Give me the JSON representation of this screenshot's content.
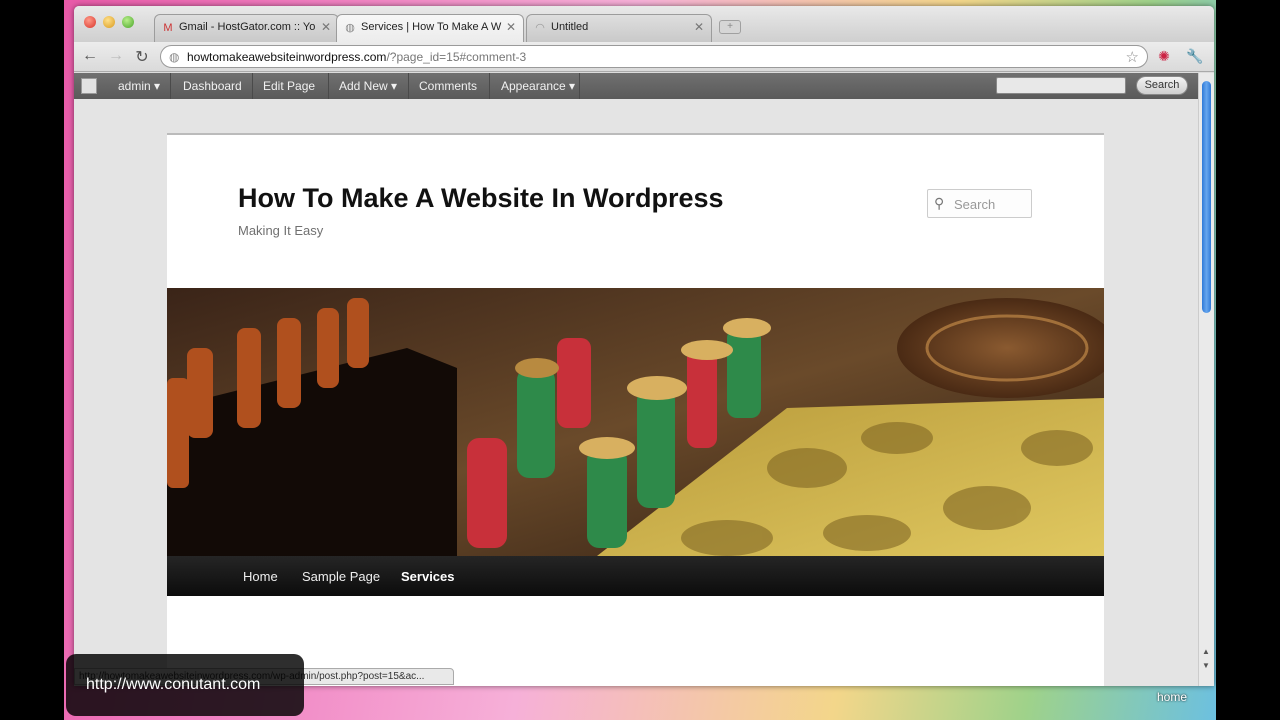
{
  "browser": {
    "tabs": [
      {
        "label": "Gmail - HostGator.com :: Yo",
        "icon": "gmail-icon",
        "active": false
      },
      {
        "label": "Services | How To Make A W",
        "icon": "globe-icon",
        "active": true
      },
      {
        "label": "Untitled",
        "icon": "loading-icon",
        "active": false
      }
    ],
    "url_host": "howtomakeawebsiteinwordpress.com",
    "url_path": "/?page_id=15#comment-3"
  },
  "adminbar": {
    "items": [
      "admin",
      "Dashboard",
      "Edit Page",
      "Add New",
      "Comments",
      "Appearance"
    ],
    "search_button": "Search"
  },
  "site": {
    "title": "How To Make A Website In Wordpress",
    "description": "Making It Easy",
    "search_placeholder": "Search",
    "nav": [
      "Home",
      "Sample Page",
      "Services"
    ],
    "current_nav": "Services"
  },
  "status_bar": "http://howtomakeawebsiteinwordpress.com/wp-admin/post.php?post=15&ac...",
  "watermark": "http://www.conutant.com",
  "desktop_label": "home",
  "colors": {
    "accent_scroll": "#2f7ad8",
    "adminbar": "#636363",
    "nav_bg": "#151515"
  }
}
